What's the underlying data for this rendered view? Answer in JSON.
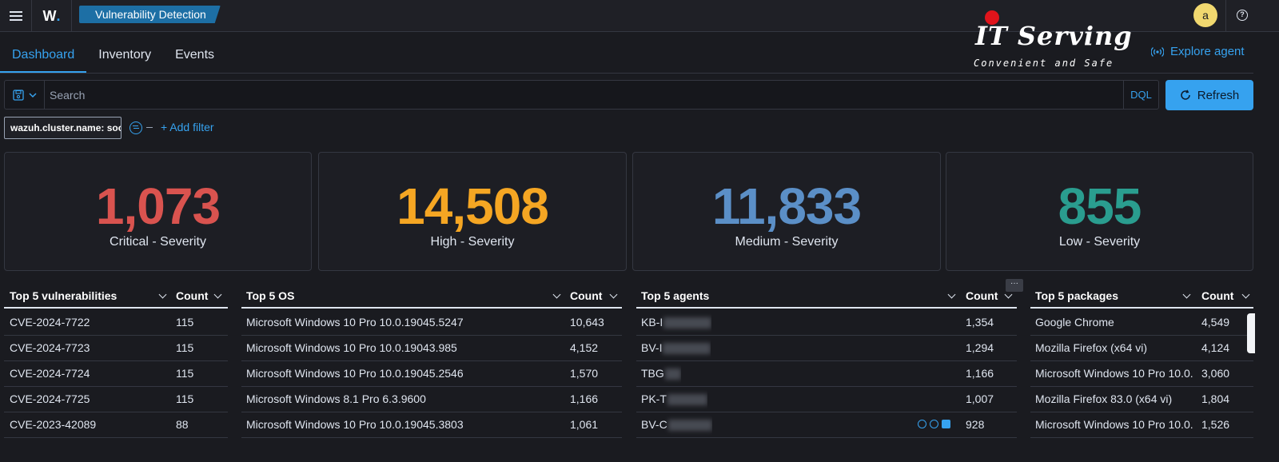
{
  "header": {
    "logo_text": "W",
    "app_title": "Vulnerability Detection",
    "avatar_initial": "a",
    "help_glyph": "?"
  },
  "watermark": {
    "name": "IT Serving",
    "tagline": "Convenient and Safe"
  },
  "tabs": [
    {
      "label": "Dashboard",
      "active": true
    },
    {
      "label": "Inventory",
      "active": false
    },
    {
      "label": "Events",
      "active": false
    }
  ],
  "explore_agent": {
    "label": "Explore agent",
    "icon": "signal-icon"
  },
  "search": {
    "placeholder": "Search",
    "language": "DQL",
    "refresh_label": "Refresh"
  },
  "filters": {
    "pill": "wazuh.cluster.name: soc",
    "add_label": "+ Add filter"
  },
  "metrics": [
    {
      "value": "1,073",
      "label": "Critical - Severity",
      "color": "#d9534f"
    },
    {
      "value": "14,508",
      "label": "High - Severity",
      "color": "#f5a623"
    },
    {
      "value": "11,833",
      "label": "Medium - Severity",
      "color": "#5b8fc7"
    },
    {
      "value": "855",
      "label": "Low - Severity",
      "color": "#2a9d8f"
    }
  ],
  "tables": {
    "vulns": {
      "title": "Top 5 vulnerabilities",
      "count_header": "Count",
      "rows": [
        {
          "name": "CVE-2024-7722",
          "count": "115"
        },
        {
          "name": "CVE-2024-7723",
          "count": "115"
        },
        {
          "name": "CVE-2024-7724",
          "count": "115"
        },
        {
          "name": "CVE-2024-7725",
          "count": "115"
        },
        {
          "name": "CVE-2023-42089",
          "count": "88"
        }
      ]
    },
    "os": {
      "title": "Top 5 OS",
      "count_header": "Count",
      "rows": [
        {
          "name": "Microsoft Windows 10 Pro 10.0.19045.5247",
          "count": "10,643"
        },
        {
          "name": "Microsoft Windows 10 Pro 10.0.19043.985",
          "count": "4,152"
        },
        {
          "name": "Microsoft Windows 10 Pro 10.0.19045.2546",
          "count": "1,570"
        },
        {
          "name": "Microsoft Windows 8.1 Pro 6.3.9600",
          "count": "1,166"
        },
        {
          "name": "Microsoft Windows 10 Pro 10.0.19045.3803",
          "count": "1,061"
        }
      ]
    },
    "agents": {
      "title": "Top 5 agents",
      "count_header": "Count",
      "rows": [
        {
          "name": "KB-I",
          "count": "1,354"
        },
        {
          "name": "BV-I",
          "count": "1,294"
        },
        {
          "name": "TBG",
          "count": "1,166"
        },
        {
          "name": "PK-T",
          "count": "1,007"
        },
        {
          "name": "BV-C",
          "count": "928"
        }
      ]
    },
    "packages": {
      "title": "Top 5 packages",
      "count_header": "Count",
      "rows": [
        {
          "name": "Google Chrome",
          "count": "4,549"
        },
        {
          "name": "Mozilla Firefox (x64 vi)",
          "count": "4,124"
        },
        {
          "name": "Microsoft Windows 10 Pro 10.0.",
          "count": "3,060"
        },
        {
          "name": "Mozilla Firefox 83.0 (x64 vi)",
          "count": "1,804"
        },
        {
          "name": "Microsoft Windows 10 Pro 10.0.",
          "count": "1,526"
        }
      ]
    }
  }
}
